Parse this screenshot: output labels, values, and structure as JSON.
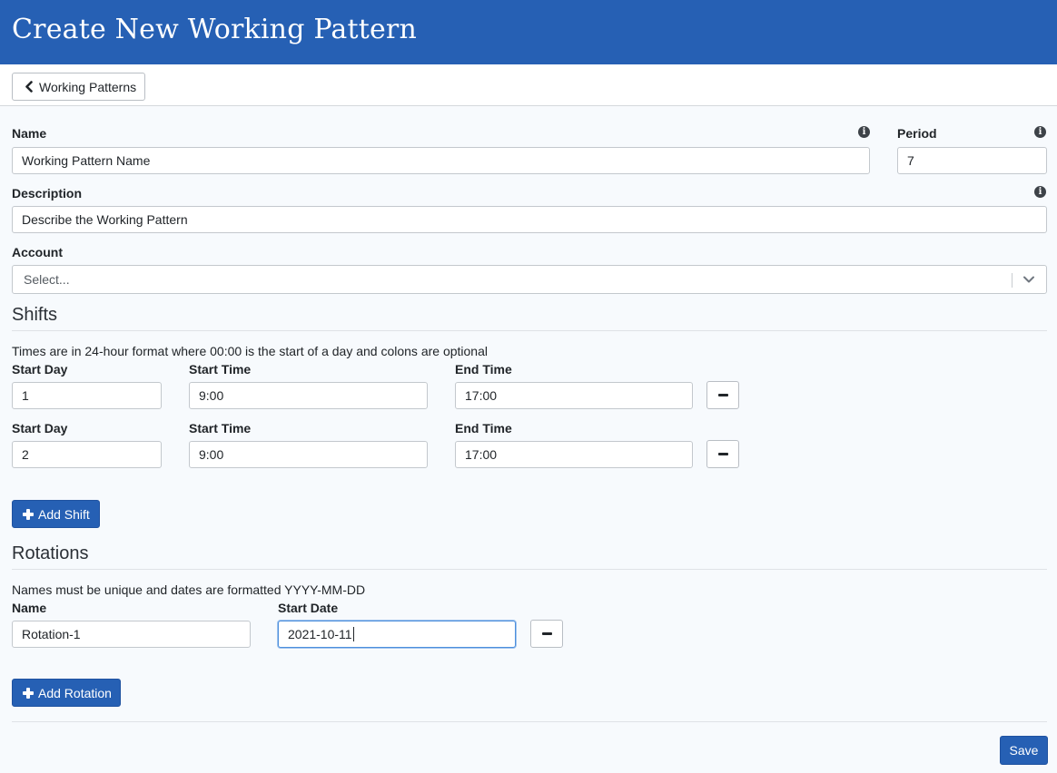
{
  "header": {
    "title": "Create New Working Pattern"
  },
  "toolbar": {
    "back_label": "Working Patterns"
  },
  "form": {
    "name": {
      "label": "Name",
      "value": "Working Pattern Name"
    },
    "period": {
      "label": "Period",
      "value": "7"
    },
    "description": {
      "label": "Description",
      "value": "Describe the Working Pattern"
    },
    "account": {
      "label": "Account",
      "placeholder": "Select..."
    }
  },
  "shifts": {
    "title": "Shifts",
    "hint": "Times are in 24-hour format where 00:00 is the start of a day and colons are optional",
    "col_start_day": "Start Day",
    "col_start_time": "Start Time",
    "col_end_time": "End Time",
    "rows": [
      {
        "start_day": "1",
        "start_time": "9:00",
        "end_time": "17:00"
      },
      {
        "start_day": "2",
        "start_time": "9:00",
        "end_time": "17:00"
      }
    ],
    "add_label": "Add Shift"
  },
  "rotations": {
    "title": "Rotations",
    "hint": "Names must be unique and dates are formatted YYYY-MM-DD",
    "col_name": "Name",
    "col_start_date": "Start Date",
    "rows": [
      {
        "name": "Rotation-1",
        "start_date": "2021-10-11"
      }
    ],
    "add_label": "Add Rotation"
  },
  "footer": {
    "save_label": "Save"
  },
  "colors": {
    "primary": "#2660b4",
    "background": "#f7fafd"
  },
  "icons": {
    "back": "chevron-left-icon",
    "info": "info-circle-icon",
    "dropdown": "chevron-down-icon",
    "remove": "minus-icon",
    "add": "plus-icon"
  }
}
